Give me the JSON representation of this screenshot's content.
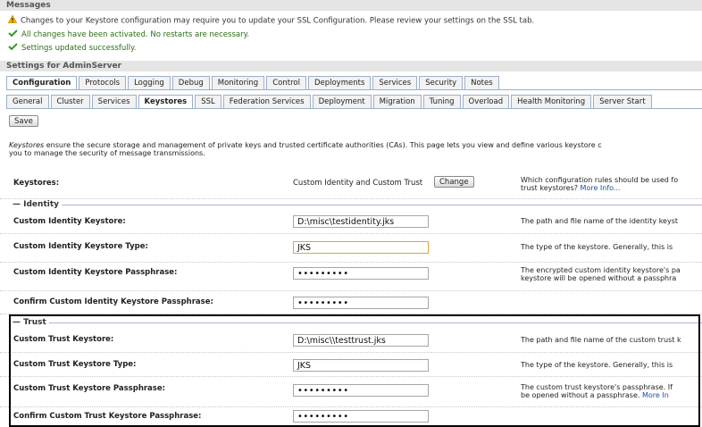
{
  "messages": {
    "title": "Messages",
    "items": [
      {
        "type": "warning",
        "text": "Changes to your Keystore configuration may require you to update your SSL Configuration. Please review your settings on the SSL tab."
      },
      {
        "type": "success",
        "text": "All changes have been activated. No restarts are necessary."
      },
      {
        "type": "success",
        "text": "Settings updated successfully."
      }
    ]
  },
  "settings_title": "Settings for AdminServer",
  "tabs_primary": [
    "Configuration",
    "Protocols",
    "Logging",
    "Debug",
    "Monitoring",
    "Control",
    "Deployments",
    "Services",
    "Security",
    "Notes"
  ],
  "tabs_secondary": [
    "General",
    "Cluster",
    "Services",
    "Keystores",
    "SSL",
    "Federation Services",
    "Deployment",
    "Migration",
    "Tuning",
    "Overload",
    "Health Monitoring",
    "Server Start"
  ],
  "save_label": "Save",
  "intro": {
    "lead": "Keystores",
    "line1": " ensure the secure storage and management of private keys and trusted certificate authorities (CAs). This page lets you view and define various keystore c",
    "line2": "you to manage the security of message transmissions."
  },
  "keystores": {
    "label": "Keystores:",
    "value": "Custom Identity and Custom Trust",
    "change_label": "Change",
    "help1": "Which configuration rules should be used fo",
    "help2": "trust keystores?",
    "more": "More Info..."
  },
  "identity": {
    "legend": "Identity",
    "keystore_label": "Custom Identity Keystore:",
    "keystore_value": "D:\\misc\\testidentity.jks",
    "keystore_help": "The path and file name of the identity keyst",
    "type_label": "Custom Identity Keystore Type:",
    "type_value": "JKS",
    "type_help": "The type of the keystore. Generally, this is",
    "pass_label": "Custom Identity Keystore Passphrase:",
    "pass_value": "•••••••••",
    "pass_help1": "The encrypted custom identity keystore's pa",
    "pass_help2": "keystore will be opened without a passphra",
    "confirm_label": "Confirm Custom Identity Keystore Passphrase:",
    "confirm_value": "•••••••••"
  },
  "trust": {
    "legend": "Trust",
    "keystore_label": "Custom Trust Keystore:",
    "keystore_value": "D:\\misc\\\\testtrust.jks",
    "keystore_help": "The path and file name of the custom trust k",
    "type_label": "Custom Trust Keystore Type:",
    "type_value": "JKS",
    "type_help": "The type of the keystore. Generally, this is",
    "pass_label": "Custom Trust Keystore Passphrase:",
    "pass_value": "•••••••••",
    "pass_help1": "The custom trust keystore's passphrase. If",
    "pass_help2": "be opened without a passphrase.",
    "pass_more": "More In",
    "confirm_label": "Confirm Custom Trust Keystore Passphrase:",
    "confirm_value": "•••••••••"
  },
  "colors": {
    "success": "#2b6e14",
    "warning": "#f0b400",
    "link": "#1c4f9c",
    "focus_border": "#e5a33c"
  }
}
